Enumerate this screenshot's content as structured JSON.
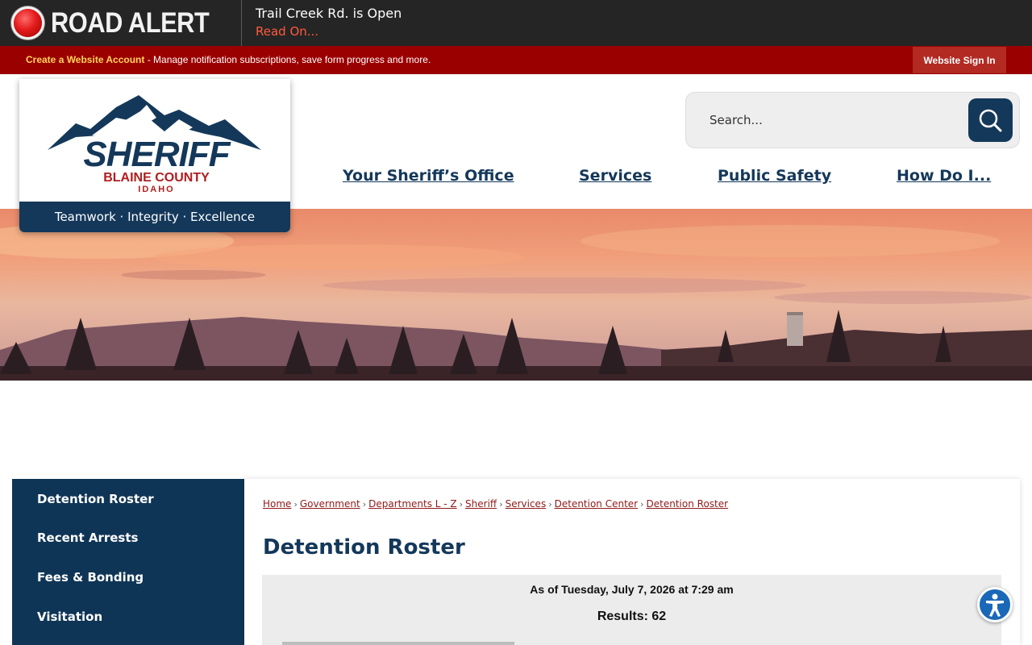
{
  "alert": {
    "title": "ROAD ALERT",
    "message": "Trail Creek Rd. is Open",
    "link": "Read On..."
  },
  "account_bar": {
    "create_link": "Create a Website Account",
    "description": " - Manage notification subscriptions, save form progress and more.",
    "signin": "Website Sign In"
  },
  "logo": {
    "name": "SHERIFF",
    "county": "BLAINE COUNTY",
    "state": "IDAHO",
    "tagline": "Teamwork · Integrity · Excellence"
  },
  "search": {
    "placeholder": "Search..."
  },
  "nav": {
    "items": [
      "Your Sheriff’s Office",
      "Services",
      "Public Safety",
      "How Do I..."
    ]
  },
  "sidebar": {
    "items": [
      "Detention Roster",
      "Recent Arrests",
      "Fees & Bonding",
      "Visitation"
    ]
  },
  "breadcrumb": [
    "Home",
    "Government",
    "Departments L - Z",
    "Sheriff",
    "Services",
    "Detention Center",
    "Detention Roster"
  ],
  "page": {
    "title": "Detention Roster",
    "as_of": "As of Tuesday, July 7, 2026 at 7:29 am",
    "results": "Results: 62"
  },
  "colors": {
    "navy": "#14385a",
    "alert_red": "#9b0000",
    "link_orange": "#ff5a3c",
    "breadcrumb_link": "#8f1a1a"
  },
  "icons": [
    "alert-dot-icon",
    "search-icon",
    "accessibility-icon"
  ]
}
